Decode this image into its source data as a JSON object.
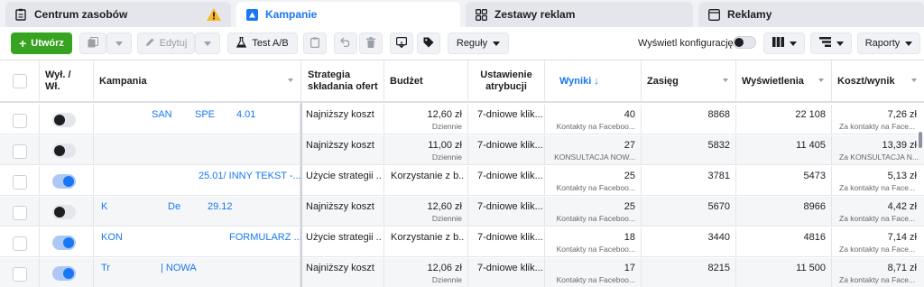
{
  "tabs": [
    {
      "label": "Centrum zasobów",
      "icon": "clipboard-icon"
    },
    {
      "label": "Kampanie",
      "icon": "campaign-folder-icon"
    },
    {
      "label": "Zestawy reklam",
      "icon": "grid-icon"
    },
    {
      "label": "Reklamy",
      "icon": "ad-window-icon"
    }
  ],
  "toolbar": {
    "create": "Utwórz",
    "edit": "Edytuj",
    "test": "Test A/B",
    "rules": "Reguły",
    "show_config": "Wyświetl konfigurację",
    "reports": "Raporty"
  },
  "colors": {
    "accent": "#1877f2",
    "create_green": "#36a420",
    "warning": "#f7b928"
  },
  "table": {
    "headers": {
      "onoff": "Wył. / Wł.",
      "campaign": "Kampania",
      "strategy": "Strategia składania ofert",
      "budget": "Budżet",
      "attribution": "Ustawienie atrybucji",
      "results": "Wyniki ↓",
      "reach": "Zasięg",
      "impressions": "Wyświetlenia",
      "cpr": "Koszt/wynik"
    },
    "rows": [
      {
        "on": false,
        "name": [
          "SAN",
          "SPE",
          "4.01"
        ],
        "strategy": "Najniższy koszt",
        "budget": "12,60 zł",
        "budget_sub": "Dziennie",
        "attr": "7-dniowe klik...",
        "results": "40",
        "results_sub": "Kontakty na Faceboo...",
        "reach": "8868",
        "impr": "22 108",
        "cpr": "7,26 zł",
        "cpr_sub": "Za kontakty na Face..."
      },
      {
        "on": false,
        "name": [],
        "strategy": "Najniższy koszt",
        "budget": "11,00 zł",
        "budget_sub": "Dziennie",
        "attr": "7-dniowe klik...",
        "results": "27",
        "results_sub": "KONSULTACJA NOW...",
        "reach": "5832",
        "impr": "11 405",
        "cpr": "13,39 zł",
        "cpr_sub": "Za KONSULTACJA N..."
      },
      {
        "on": true,
        "name": [
          "25.01/ INNY TEKST -..."
        ],
        "strategy": "Użycie strategii ...",
        "budget": "Korzystanie z b...",
        "budget_sub": "",
        "attr": "7-dniowe klik...",
        "results": "25",
        "results_sub": "Kontakty na Faceboo...",
        "reach": "3781",
        "impr": "5473",
        "cpr": "5,13 zł",
        "cpr_sub": "Za kontakty na Face..."
      },
      {
        "on": false,
        "name": [
          "K",
          "De",
          "29.12"
        ],
        "strategy": "Najniższy koszt",
        "budget": "12,60 zł",
        "budget_sub": "Dziennie",
        "attr": "7-dniowe klik...",
        "results": "25",
        "results_sub": "Kontakty na Faceboo...",
        "reach": "5670",
        "impr": "8966",
        "cpr": "4,42 zł",
        "cpr_sub": "Za kontakty na Face..."
      },
      {
        "on": true,
        "name": [
          "KON",
          "FORMULARZ ..."
        ],
        "strategy": "Użycie strategii ...",
        "budget": "Korzystanie z b...",
        "budget_sub": "",
        "attr": "7-dniowe klik...",
        "results": "18",
        "results_sub": "Kontakty na Faceboo...",
        "reach": "3440",
        "impr": "4816",
        "cpr": "7,14 zł",
        "cpr_sub": "Za kontakty na Face..."
      },
      {
        "on": true,
        "name": [
          "Tr",
          "| NOWA"
        ],
        "strategy": "Najniższy koszt",
        "budget": "12,06 zł",
        "budget_sub": "Dziennie",
        "attr": "7-dniowe klik...",
        "results": "17",
        "results_sub": "Kontakty na Faceboo...",
        "reach": "8215",
        "impr": "11 500",
        "cpr": "8,71 zł",
        "cpr_sub": "Za kontakty na Face..."
      }
    ]
  }
}
